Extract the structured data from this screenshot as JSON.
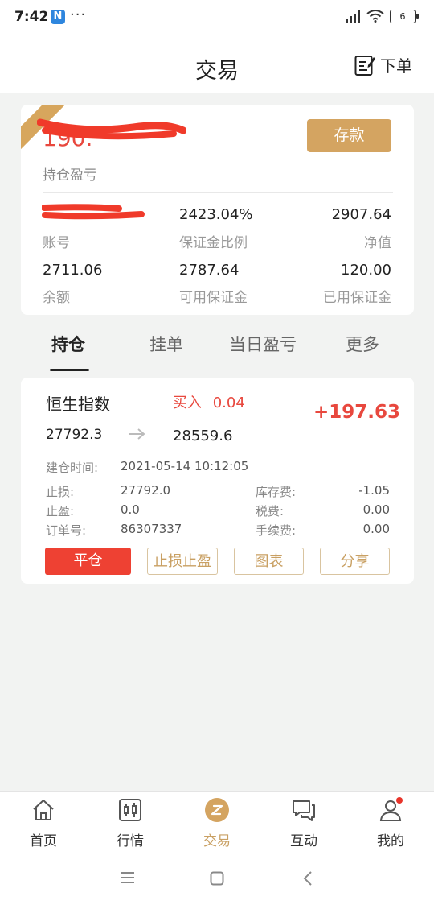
{
  "status_bar": {
    "time": "7:42",
    "notification_badge": "N",
    "more_dots": "···",
    "battery": "6"
  },
  "header": {
    "title": "交易",
    "order_label": "下单"
  },
  "account": {
    "pnl_value": "190.",
    "pnl_label": "持仓盈亏",
    "deposit_label": "存款",
    "account_no_label": "账号",
    "margin_ratio_value": "2423.04%",
    "margin_ratio_label": "保证金比例",
    "net_value": "2907.64",
    "net_label": "净值",
    "balance_value": "2711.06",
    "balance_label": "余额",
    "available_margin_value": "2787.64",
    "available_margin_label": "可用保证金",
    "used_margin_value": "120.00",
    "used_margin_label": "已用保证金"
  },
  "tabs": [
    {
      "label": "持仓",
      "active": true
    },
    {
      "label": "挂单",
      "active": false
    },
    {
      "label": "当日盈亏",
      "active": false
    },
    {
      "label": "更多",
      "active": false
    }
  ],
  "position": {
    "symbol": "恒生指数",
    "direction": "买入",
    "lots": "0.04",
    "profit": "+197.63",
    "open_price": "27792.3",
    "current_price": "28559.6",
    "open_time_label": "建仓时间:",
    "open_time": "2021-05-14 10:12:05",
    "stop_loss_label": "止损:",
    "stop_loss": "27792.0",
    "take_profit_label": "止盈:",
    "take_profit": "0.0",
    "order_no_label": "订单号:",
    "order_no": "86307337",
    "swap_label": "库存费:",
    "swap": "-1.05",
    "tax_label": "税费:",
    "tax": "0.00",
    "fee_label": "手续费:",
    "fee": "0.00",
    "buttons": {
      "close": "平仓",
      "sl_tp": "止损止盈",
      "chart": "图表",
      "share": "分享"
    }
  },
  "bottom_nav": [
    {
      "label": "首页",
      "icon": "home-icon"
    },
    {
      "label": "行情",
      "icon": "market-chart-icon"
    },
    {
      "label": "交易",
      "icon": "trade-icon",
      "active": true
    },
    {
      "label": "互动",
      "icon": "chat-icon"
    },
    {
      "label": "我的",
      "icon": "profile-icon"
    }
  ],
  "colors": {
    "accent_gold": "#d4a461",
    "loss_red": "#e8483e",
    "close_red": "#ee4133"
  }
}
